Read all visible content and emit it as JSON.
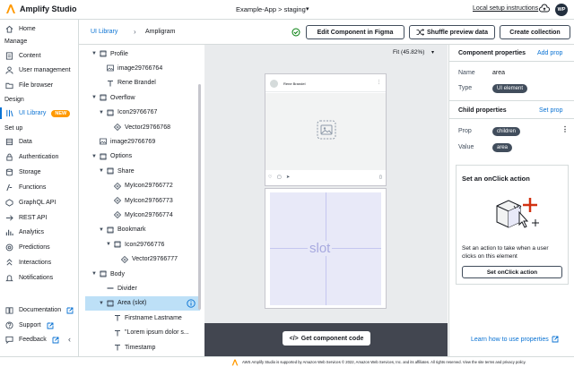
{
  "app": {
    "title": "Amplify Studio",
    "environment": "Example-App > staging",
    "local_setup": "Local setup instructions",
    "avatar_initials": "WP"
  },
  "leftnav": {
    "home": "Home",
    "manage_section": "Manage",
    "manage_items": [
      "Content",
      "User management",
      "File browser"
    ],
    "design_section": "Design",
    "design_items": [
      "UI Library"
    ],
    "new_badge": "NEW",
    "setup_section": "Set up",
    "setup_items": [
      "Data",
      "Authentication",
      "Storage",
      "Functions",
      "GraphQL API",
      "REST API",
      "Analytics",
      "Predictions",
      "Interactions",
      "Notifications"
    ],
    "bottom_items": [
      "Documentation",
      "Support",
      "Feedback"
    ]
  },
  "breadcrumb": {
    "parent": "UI Library",
    "current": "Ampligram"
  },
  "toolbar": {
    "figma_label": "Edit Component in Figma",
    "shuffle_label": "Shuffle preview data",
    "create_label": "Create collection"
  },
  "tree": {
    "rows": [
      {
        "label": "Profile",
        "caret": "▼",
        "icon": "frame"
      },
      {
        "label": "image29766764",
        "caret": "",
        "icon": "image"
      },
      {
        "label": "Rene Brandel",
        "caret": "",
        "icon": "text"
      },
      {
        "label": "Overflow",
        "caret": "▼",
        "icon": "frame"
      },
      {
        "label": "Icon29766767",
        "caret": "▼",
        "icon": "frame"
      },
      {
        "label": "Vector29766768",
        "caret": "",
        "icon": "vector"
      },
      {
        "label": "image29766769",
        "caret": "",
        "icon": "image"
      },
      {
        "label": "Options",
        "caret": "▼",
        "icon": "frame"
      },
      {
        "label": "Share",
        "caret": "▼",
        "icon": "frame"
      },
      {
        "label": "MyIcon29766772",
        "caret": "",
        "icon": "vector"
      },
      {
        "label": "MyIcon29766773",
        "caret": "",
        "icon": "vector"
      },
      {
        "label": "MyIcon29766774",
        "caret": "",
        "icon": "vector"
      },
      {
        "label": "Bookmark",
        "caret": "▼",
        "icon": "frame"
      },
      {
        "label": "Icon29766776",
        "caret": "▼",
        "icon": "frame"
      },
      {
        "label": "Vector29766777",
        "caret": "",
        "icon": "vector"
      },
      {
        "label": "Body",
        "caret": "▼",
        "icon": "frame"
      },
      {
        "label": "Divider",
        "caret": "",
        "icon": "divider"
      },
      {
        "label": "Area (slot)",
        "caret": "▼",
        "icon": "frame"
      },
      {
        "label": "Firstname Lastname",
        "caret": "",
        "icon": "text"
      },
      {
        "label": "\"Lorem ipsum dolor s...",
        "caret": "",
        "icon": "text"
      },
      {
        "label": "Timestamp",
        "caret": "",
        "icon": "text"
      }
    ]
  },
  "canvas": {
    "fit_label": "Fit (45.82%)",
    "card_name": "Rene Brandel",
    "slot_label": "slot",
    "get_code_label": "Get component code"
  },
  "component_properties": {
    "heading": "Component properties",
    "add_prop": "Add prop",
    "name_label": "Name",
    "name_value": "area",
    "type_label": "Type",
    "type_value": "UI element"
  },
  "child_properties": {
    "heading": "Child properties",
    "set_prop": "Set prop",
    "prop_label": "Prop",
    "prop_value": "children",
    "value_label": "Value",
    "value_value": "area"
  },
  "onclick": {
    "title": "Set an onClick action",
    "description": "Set an action to take when a user clicks on this element",
    "button": "Set onClick action"
  },
  "learn_link": "Learn how to use properties",
  "footer": {
    "text": "AWS Amplify Studio is supported by Amazon Web Services © 2022, Amazon Web Services, Inc. and its affiliates. All rights reserved. View the site terms and privacy policy."
  },
  "colors": {
    "accent": "#0972d3",
    "badge": "#ff9900",
    "selected_row": "#bde0f7",
    "slot_fill": "#e8e9f8",
    "canvas_bg": "#e9ebed",
    "footer_bar": "#424650"
  }
}
